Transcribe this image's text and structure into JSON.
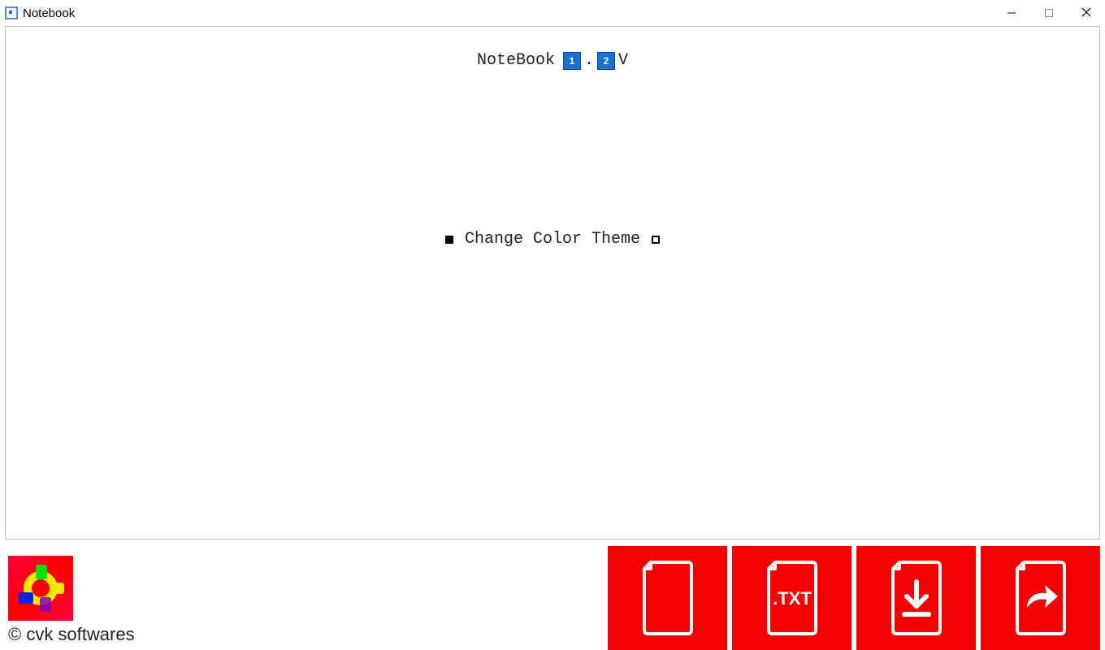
{
  "window": {
    "title": "Notebook"
  },
  "main": {
    "app_name": "NoteBook",
    "version_major": "1",
    "version_minor": "2",
    "version_suffix": "V",
    "theme_label": "Change Color Theme"
  },
  "footer": {
    "copyright": "© cvk softwares",
    "buttons": {
      "new_doc": "new-document",
      "txt_doc": ".TXT",
      "download": "download",
      "share": "share"
    }
  },
  "icons": {
    "app": "notebook-app-icon",
    "minimize": "minimize-icon",
    "maximize": "maximize-icon",
    "close": "close-icon",
    "logo": "cvk-logo-icon",
    "new_doc": "document-blank-icon",
    "txt_doc": "document-txt-icon",
    "download": "document-download-icon",
    "share": "document-share-icon"
  }
}
